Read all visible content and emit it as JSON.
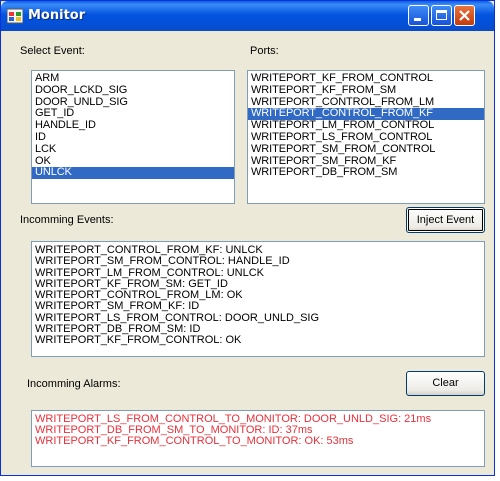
{
  "window": {
    "title": "Monitor",
    "accent": "#0454e0"
  },
  "title_buttons": [
    "minimize-icon",
    "maximize-icon",
    "close-icon"
  ],
  "select_event": {
    "label": "Select Event:",
    "items": [
      "ARM",
      "DOOR_LCKD_SIG",
      "DOOR_UNLD_SIG",
      "GET_ID",
      "HANDLE_ID",
      "ID",
      "LCK",
      "OK",
      "UNLCK"
    ],
    "selected": "UNLCK"
  },
  "ports": {
    "label": "Ports:",
    "items": [
      "WRITEPORT_KF_FROM_CONTROL",
      "WRITEPORT_KF_FROM_SM",
      "WRITEPORT_CONTROL_FROM_LM",
      "WRITEPORT_CONTROL_FROM_KF",
      "WRITEPORT_LM_FROM_CONTROL",
      "WRITEPORT_LS_FROM_CONTROL",
      "WRITEPORT_SM_FROM_CONTROL",
      "WRITEPORT_SM_FROM_KF",
      "WRITEPORT_DB_FROM_SM"
    ],
    "selected": "WRITEPORT_CONTROL_FROM_KF"
  },
  "inject_button": "Inject Event",
  "incoming_events": {
    "label": "Incomming Events:",
    "lines": [
      "WRITEPORT_CONTROL_FROM_KF: UNLCK",
      "WRITEPORT_SM_FROM_CONTROL: HANDLE_ID",
      "WRITEPORT_LM_FROM_CONTROL: UNLCK",
      "WRITEPORT_KF_FROM_SM: GET_ID",
      "WRITEPORT_CONTROL_FROM_LM: OK",
      "WRITEPORT_SM_FROM_KF: ID",
      "WRITEPORT_LS_FROM_CONTROL:  DOOR_UNLD_SIG",
      "WRITEPORT_DB_FROM_SM: ID",
      "WRITEPORT_KF_FROM_CONTROL: OK"
    ]
  },
  "incoming_alarms": {
    "label": "Incomming Alarms:",
    "color": "#e8303a",
    "lines": [
      "WRITEPORT_LS_FROM_CONTROL_TO_MONITOR: DOOR_UNLD_SIG: 21ms",
      "WRITEPORT_DB_FROM_SM_TO_MONITOR: ID: 37ms",
      "WRITEPORT_KF_FROM_CONTROL_TO_MONITOR: OK: 53ms"
    ]
  },
  "clear_button": "Clear"
}
